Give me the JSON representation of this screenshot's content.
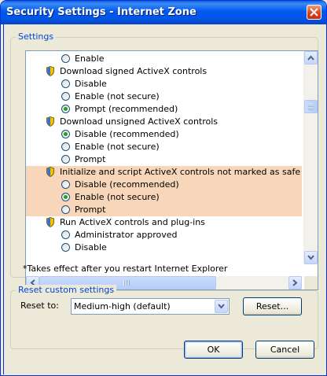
{
  "window": {
    "title": "Security Settings - Internet Zone",
    "close_icon": "close-icon"
  },
  "settings_group": {
    "legend": "Settings",
    "rows": [
      {
        "type": "option",
        "label": "Enable",
        "checked": false
      },
      {
        "type": "category",
        "label": "Download signed ActiveX controls",
        "icon": "shield-icon"
      },
      {
        "type": "option",
        "label": "Disable",
        "checked": false
      },
      {
        "type": "option",
        "label": "Enable (not secure)",
        "checked": false
      },
      {
        "type": "option",
        "label": "Prompt (recommended)",
        "checked": true
      },
      {
        "type": "category",
        "label": "Download unsigned ActiveX controls",
        "icon": "shield-icon"
      },
      {
        "type": "option",
        "label": "Disable (recommended)",
        "checked": true
      },
      {
        "type": "option",
        "label": "Enable (not secure)",
        "checked": false
      },
      {
        "type": "option",
        "label": "Prompt",
        "checked": false
      },
      {
        "type": "category",
        "label": "Initialize and script ActiveX controls not marked as safe for scripting",
        "icon": "shield-icon",
        "highlight": true
      },
      {
        "type": "option",
        "label": "Disable (recommended)",
        "checked": false,
        "highlight": true
      },
      {
        "type": "option",
        "label": "Enable (not secure)",
        "checked": true,
        "highlight": true
      },
      {
        "type": "option",
        "label": "Prompt",
        "checked": false,
        "highlight": true
      },
      {
        "type": "category",
        "label": "Run ActiveX controls and plug-ins",
        "icon": "shield-icon"
      },
      {
        "type": "option",
        "label": "Administrator approved",
        "checked": false
      },
      {
        "type": "option",
        "label": "Disable",
        "checked": false
      }
    ],
    "footnote": "*Takes effect after you restart Internet Explorer"
  },
  "reset_group": {
    "legend": "Reset custom settings",
    "reset_to_label": "Reset to:",
    "reset_to_value": "Medium-high (default)",
    "reset_button": "Reset..."
  },
  "footer": {
    "ok_label": "OK",
    "cancel_label": "Cancel"
  },
  "colors": {
    "highlight_row": "#f7d6b9",
    "title_bar": "#0058ee",
    "accent_text": "#0046d5"
  }
}
